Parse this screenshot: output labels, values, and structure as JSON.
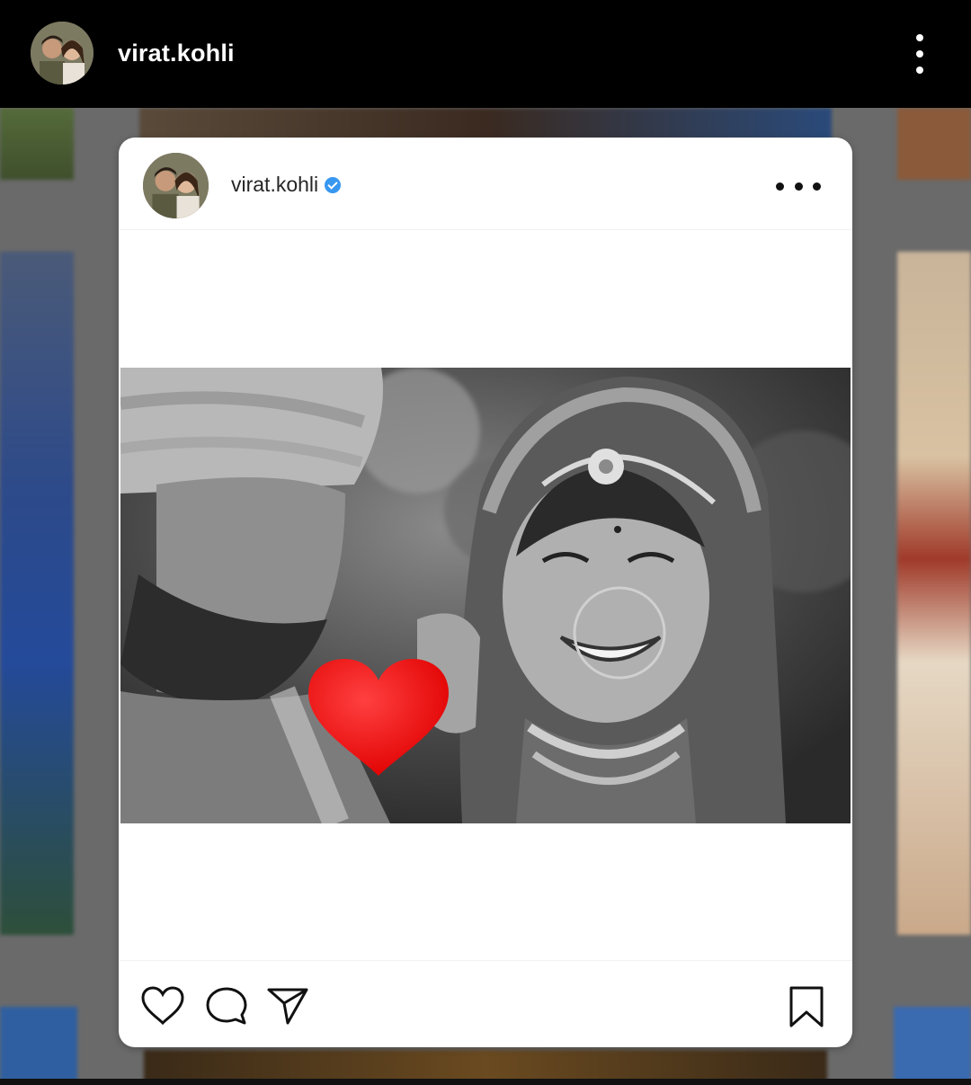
{
  "header": {
    "username": "virat.kohli",
    "avatar": "profile-photo",
    "more_icon": "more-vertical-icon"
  },
  "post": {
    "username": "virat.kohli",
    "verified": true,
    "verified_icon": "verified-badge-icon",
    "options_icon": "more-horizontal-icon",
    "image": "black-and-white wedding photo with red heart overlay",
    "overlay_icon": "red-heart-icon",
    "actions": {
      "like_icon": "heart-outline-icon",
      "comment_icon": "comment-bubble-icon",
      "share_icon": "paper-plane-icon",
      "save_icon": "bookmark-icon"
    }
  },
  "colors": {
    "topbar": "#000000",
    "card": "#ffffff",
    "verified": "#3897f0",
    "heart": "#ff1a1a"
  }
}
